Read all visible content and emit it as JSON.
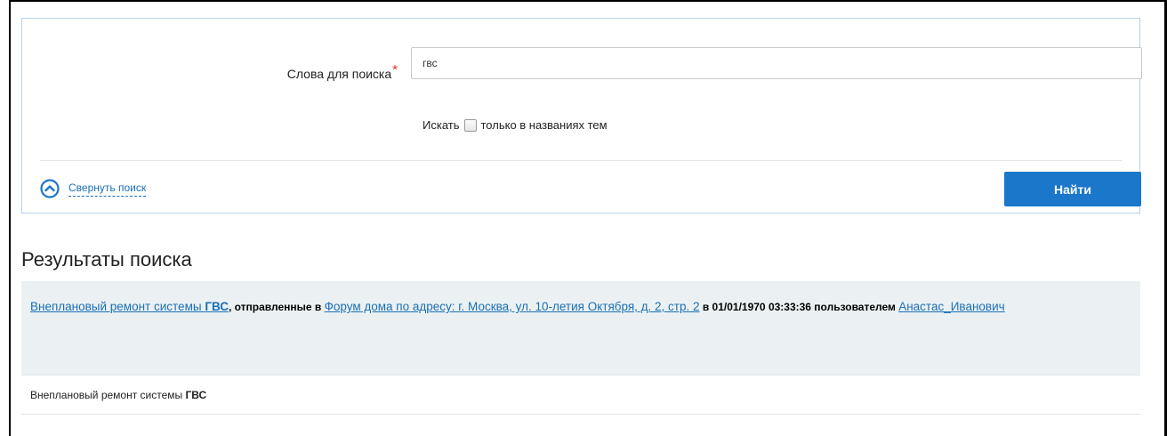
{
  "search": {
    "label": "Слова для поиска",
    "required_mark": "*",
    "value": "гвс",
    "option_prefix": "Искать",
    "option_label": "только в названиях тем",
    "option_checked": false,
    "collapse_label": "Свернуть поиск",
    "find_label": "Найти"
  },
  "results": {
    "title": "Результаты поиска",
    "items": [
      {
        "topic_plain": "Внеплановый ремонт системы ",
        "topic_highlight": "ГВС",
        "sent_in": ", отправленные в ",
        "forum": "Форум дома по адресу: г. Москва, ул. 10-летия Октября, д. 2, стр. 2",
        "date_text": " в 01/01/1970 03:33:36 пользователем ",
        "user": "Анастас_Иванович",
        "snippet_plain": "Внеплановый ремонт системы ",
        "snippet_highlight": "ГВС"
      }
    ]
  },
  "colors": {
    "accent": "#1a77c9",
    "link": "#1a6fb5",
    "required": "#e0322b",
    "result_bg": "#ebf1f2",
    "panel_border": "#b7d2ea"
  }
}
